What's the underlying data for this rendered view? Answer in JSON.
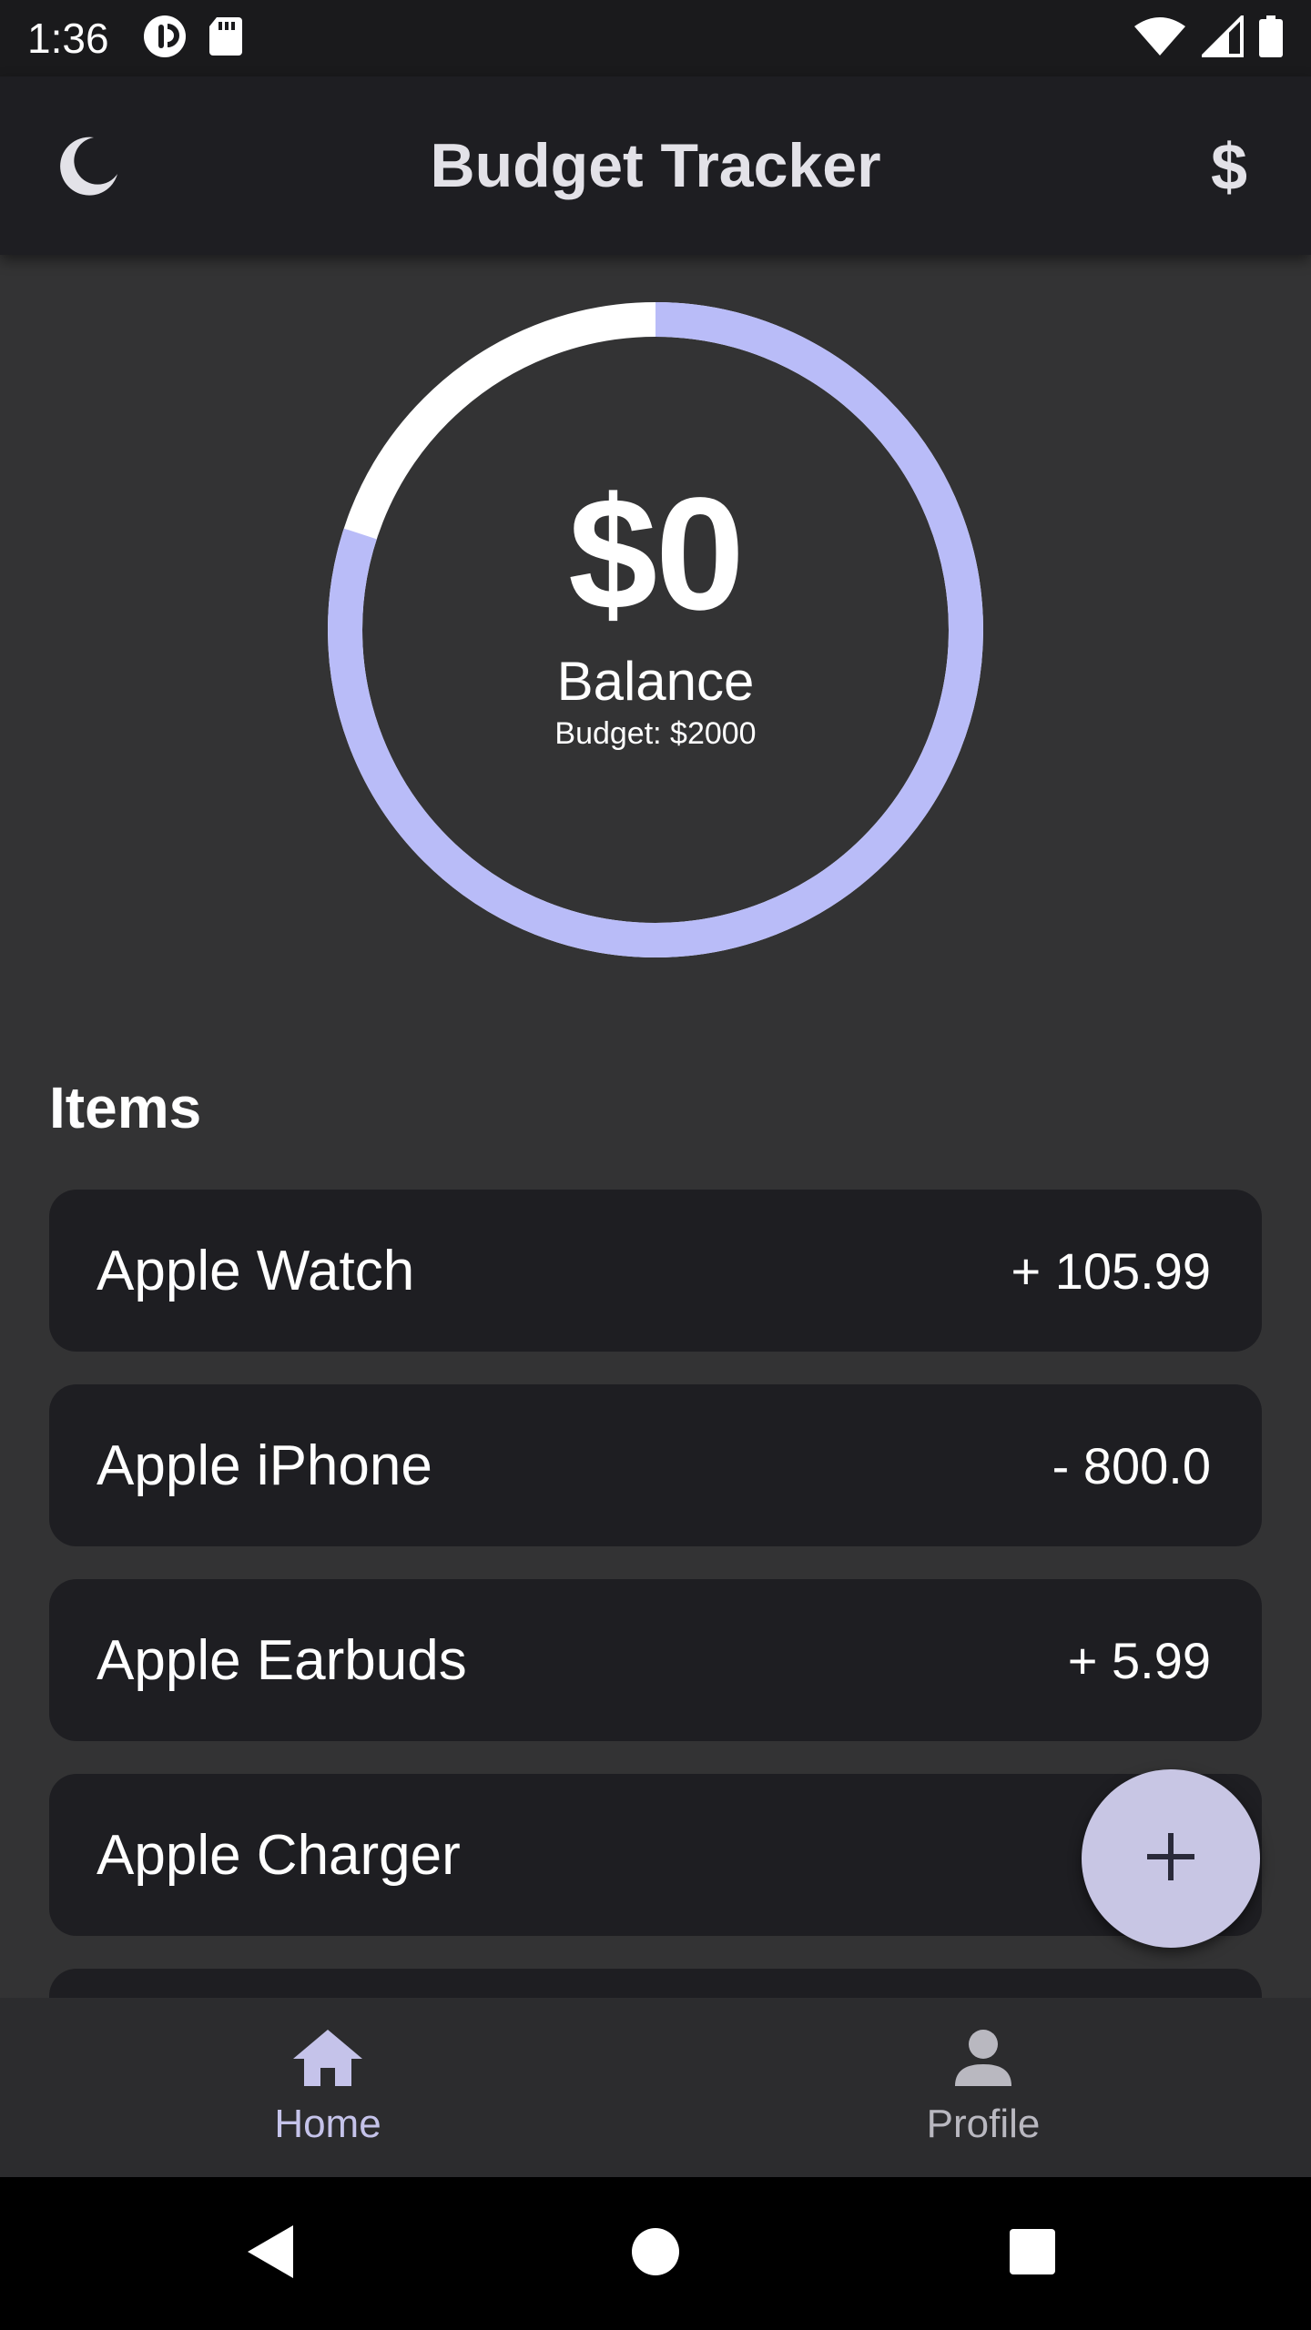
{
  "status_bar": {
    "time": "1:36",
    "icons": [
      "record-icon",
      "sd-card-icon",
      "wifi-icon",
      "signal-icon",
      "battery-icon"
    ]
  },
  "app_bar": {
    "title": "Budget Tracker",
    "currency_symbol": "$",
    "theme_icon": "moon-icon"
  },
  "summary": {
    "balance": "$0",
    "balance_label": "Balance",
    "budget_text": "Budget: $2000",
    "ring_progress": 0.8
  },
  "items_section": {
    "heading": "Items",
    "items": [
      {
        "name": "Apple Watch",
        "amount": "+ 105.99"
      },
      {
        "name": "Apple iPhone",
        "amount": "- 800.0"
      },
      {
        "name": "Apple Earbuds",
        "amount": "+ 5.99"
      },
      {
        "name": "Apple Charger",
        "amount": ""
      },
      {
        "name": "",
        "amount": ""
      }
    ]
  },
  "fab": {
    "icon": "plus-icon"
  },
  "bottom_nav": {
    "items": [
      {
        "label": "Home",
        "icon": "home-icon",
        "active": true
      },
      {
        "label": "Profile",
        "icon": "person-icon",
        "active": false
      }
    ]
  },
  "system_nav": {
    "icons": [
      "back-icon",
      "home-circle-icon",
      "recents-icon"
    ]
  },
  "colors": {
    "accent": "#b9bcf8",
    "ring_track": "#ffffff",
    "fab": "#c8c6e4",
    "card": "#1e1e22",
    "background": "#333334"
  }
}
